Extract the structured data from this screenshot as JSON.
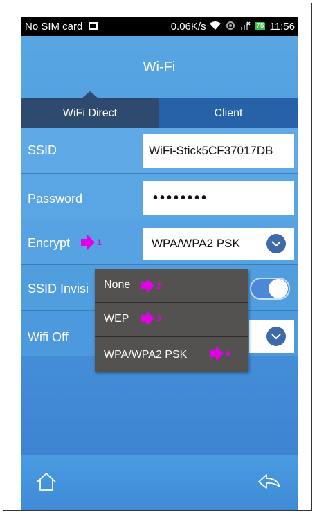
{
  "status_bar": {
    "carrier": "No SIM card",
    "speed": "0.06K/s",
    "battery": "75",
    "time": "11:56"
  },
  "title": "Wi-Fi",
  "tabs": [
    {
      "label": "WiFi Direct",
      "selected": true
    },
    {
      "label": "Client",
      "selected": false
    }
  ],
  "form": {
    "ssid_label": "SSID",
    "ssid_value": "WiFi-Stick5CF37017DB",
    "password_label": "Password",
    "password_value": "••••••••",
    "encrypt_label": "Encrypt",
    "encrypt_value": "WPA/WPA2 PSK",
    "ssid_invisible_label": "SSID Invisi",
    "wifi_off_label": "Wifi Off"
  },
  "dropdown": {
    "options": [
      "None",
      "WEP",
      "WPA/WPA2 PSK"
    ]
  },
  "annotations": [
    "1",
    "2",
    "3",
    "4"
  ],
  "colors": {
    "accent": "#4c98dc",
    "tab_selected": "#2f4a6f",
    "tab_unselected": "#2762a8",
    "annotation_arrow": "#e400e4",
    "dropdown_bg": "#545250"
  },
  "icons": {
    "home": "home-icon",
    "back": "back-icon",
    "chevron": "chevron-down-icon"
  }
}
